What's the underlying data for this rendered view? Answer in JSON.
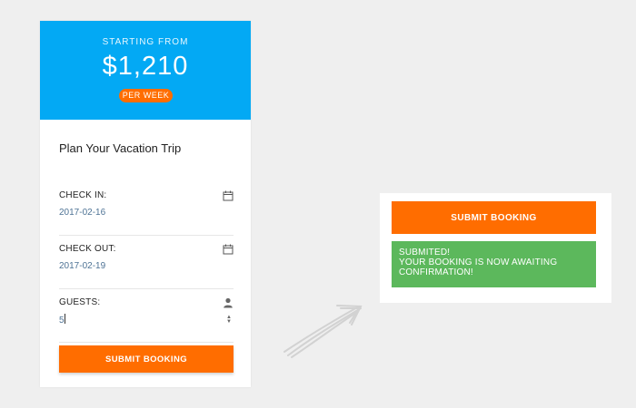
{
  "pricing": {
    "starting_label": "STARTING FROM",
    "price": "$1,210",
    "period_badge": "PER WEEK",
    "header_color": "#03a9f4",
    "accent_color": "#ff6d00"
  },
  "booking_form": {
    "title": "Plan Your Vacation Trip",
    "fields": {
      "check_in": {
        "label": "CHECK IN:",
        "value": "2017-02-16",
        "icon": "calendar-icon"
      },
      "check_out": {
        "label": "CHECK OUT:",
        "value": "2017-02-19",
        "icon": "calendar-icon"
      },
      "guests": {
        "label": "GUESTS:",
        "value": "5",
        "icon": "person-icon"
      }
    },
    "submit_label": "SUBMIT BOOKING"
  },
  "result": {
    "submit_label": "SUBMIT BOOKING",
    "message_line1": "SUBMITED!",
    "message_line2": "YOUR BOOKING IS NOW AWAITING",
    "message_line3": "CONFIRMATION!",
    "success_color": "#5cb85c"
  },
  "decoration": {
    "arrow_icon": "sketch-arrow-icon"
  }
}
